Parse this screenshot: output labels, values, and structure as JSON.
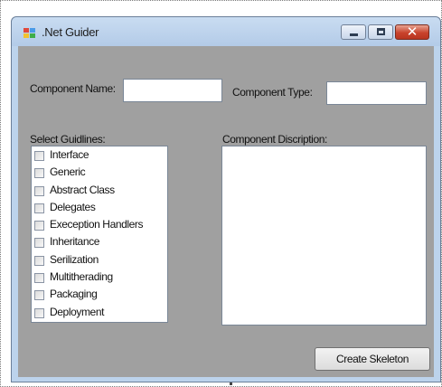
{
  "window": {
    "title": ".Net Guider"
  },
  "form": {
    "component_name_label": "Component Name:",
    "component_name_value": "",
    "component_type_label": "Component Type:",
    "component_type_value": "",
    "guidelines_label": "Select Guidlines:",
    "description_label": "Component Discription:",
    "description_value": "",
    "guidelines": [
      {
        "label": "Interface",
        "checked": false
      },
      {
        "label": "Generic",
        "checked": false
      },
      {
        "label": "Abstract Class",
        "checked": false
      },
      {
        "label": "Delegates",
        "checked": false
      },
      {
        "label": "Exeception Handlers",
        "checked": false
      },
      {
        "label": "Inheritance",
        "checked": false
      },
      {
        "label": "Serilization",
        "checked": false
      },
      {
        "label": "Multitherading",
        "checked": false
      },
      {
        "label": "Packaging",
        "checked": false
      },
      {
        "label": "Deployment",
        "checked": false
      }
    ],
    "create_button_label": "Create Skeleton"
  },
  "icons": {
    "app": "app-window-icon",
    "minimize": "minimize-icon",
    "maximize": "maximize-icon",
    "close": "close-icon"
  },
  "colors": {
    "client_background": "#a0a0a0",
    "titlebar": "#bcd3ec",
    "close_button": "#c8432c"
  }
}
